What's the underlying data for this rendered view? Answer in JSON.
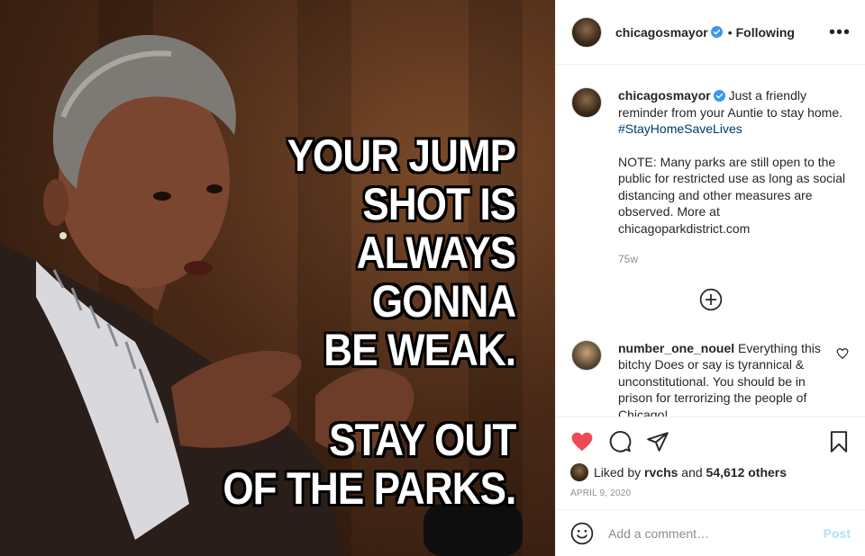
{
  "media": {
    "meme_top": [
      "YOUR JUMP",
      "SHOT IS",
      "ALWAYS",
      "GONNA",
      "BE WEAK."
    ],
    "meme_bottom": [
      "STAY OUT",
      "OF THE PARKS."
    ]
  },
  "header": {
    "username": "chicagosmayor",
    "separator": "•",
    "follow_status": "Following",
    "more_label": "•••"
  },
  "caption": {
    "username": "chicagosmayor",
    "text_before_tag": "Just a friendly reminder from your Auntie to stay home.",
    "hashtag": "#StayHomeSaveLives",
    "note": "NOTE: Many parks are still open to the public for restricted use as long as social distancing and other measures are observed. More at chicagoparkdistrict.com",
    "time": "75w"
  },
  "comments": [
    {
      "username": "number_one_nouel",
      "text": "Everything this bitchy Does or say is tyrannical & unconstitutional. You should be in prison for terrorizing the people of Chicago!"
    }
  ],
  "likes": {
    "prefix": "Liked by",
    "user": "rvchs",
    "joiner": "and",
    "others": "54,612 others"
  },
  "post_date": "APRIL 9, 2020",
  "add_comment": {
    "placeholder": "Add a comment…",
    "post_label": "Post"
  },
  "icons": {
    "verified": "verified-badge-icon",
    "like": "heart-filled-icon",
    "comment": "comment-bubble-icon",
    "share": "paper-plane-icon",
    "save": "bookmark-icon",
    "load_more": "plus-circle-icon",
    "emoji": "smiley-icon"
  },
  "colors": {
    "like_red": "#ed4956",
    "verified_blue": "#3897f0",
    "hashtag_blue": "#00376b",
    "post_disabled": "#b2dffc",
    "muted_text": "#8e8e8e"
  }
}
